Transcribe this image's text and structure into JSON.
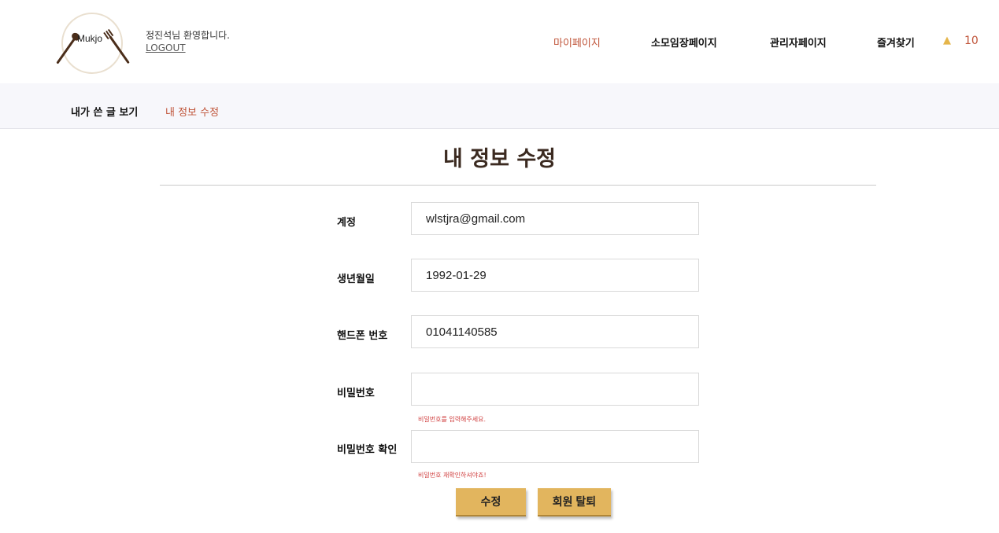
{
  "header": {
    "logo_text": "Mukjo",
    "welcome": "정진석님 환영합니다.",
    "logout": "LOGOUT",
    "nav": [
      {
        "label": "마이페이지",
        "active": true
      },
      {
        "label": "소모임장페이지",
        "active": false
      },
      {
        "label": "관리자페이지",
        "active": false
      },
      {
        "label": "즐겨찾기",
        "active": false
      }
    ],
    "notification_icon": "bell-icon",
    "notification_count": "10"
  },
  "subnav": {
    "items": [
      {
        "label": "내가 쓴 글 보기",
        "active": false
      },
      {
        "label": "내 정보 수정",
        "active": true
      }
    ]
  },
  "page": {
    "title": "내 정보 수정"
  },
  "form": {
    "account_label": "계정",
    "account_value": "wlstjra@gmail.com",
    "birth_label": "생년월일",
    "birth_value": "1992-01-29",
    "phone_label": "핸드폰 번호",
    "phone_value": "01041140585",
    "password_label": "비밀번호",
    "password_value": "",
    "password_hint": "비밀번호를 입력해주세요.",
    "password_confirm_label": "비밀번호 확인",
    "password_confirm_value": "",
    "password_confirm_hint": "비밀번호 재확인하셔야죠!",
    "submit_label": "수정",
    "withdraw_label": "회원 탈퇴"
  },
  "colors": {
    "accent": "#c0553a",
    "button": "#e2b55e",
    "subnav_bg": "#f7f7fb"
  }
}
